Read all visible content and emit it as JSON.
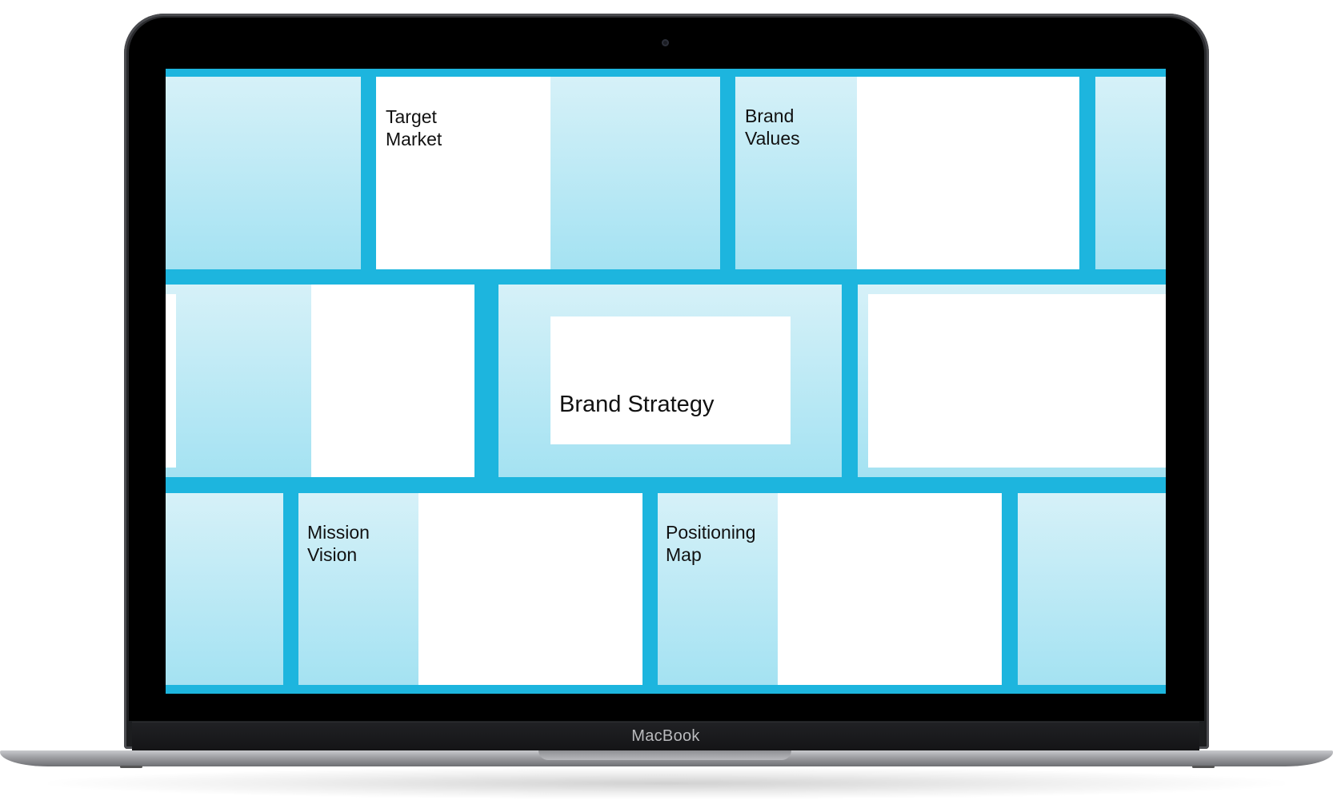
{
  "device": {
    "brand_label": "MacBook"
  },
  "board": {
    "colors": {
      "background": "#1db5de",
      "card_top": "#d6f1f8",
      "card_bottom": "#a4e2f2",
      "note": "#ffffff"
    },
    "target_market": "Target\nMarket",
    "brand_values": "Brand\nValues",
    "brand_strategy": "Brand Strategy",
    "mission_vision": "Mission\nVision",
    "positioning_map": "Positioning\nMap"
  }
}
